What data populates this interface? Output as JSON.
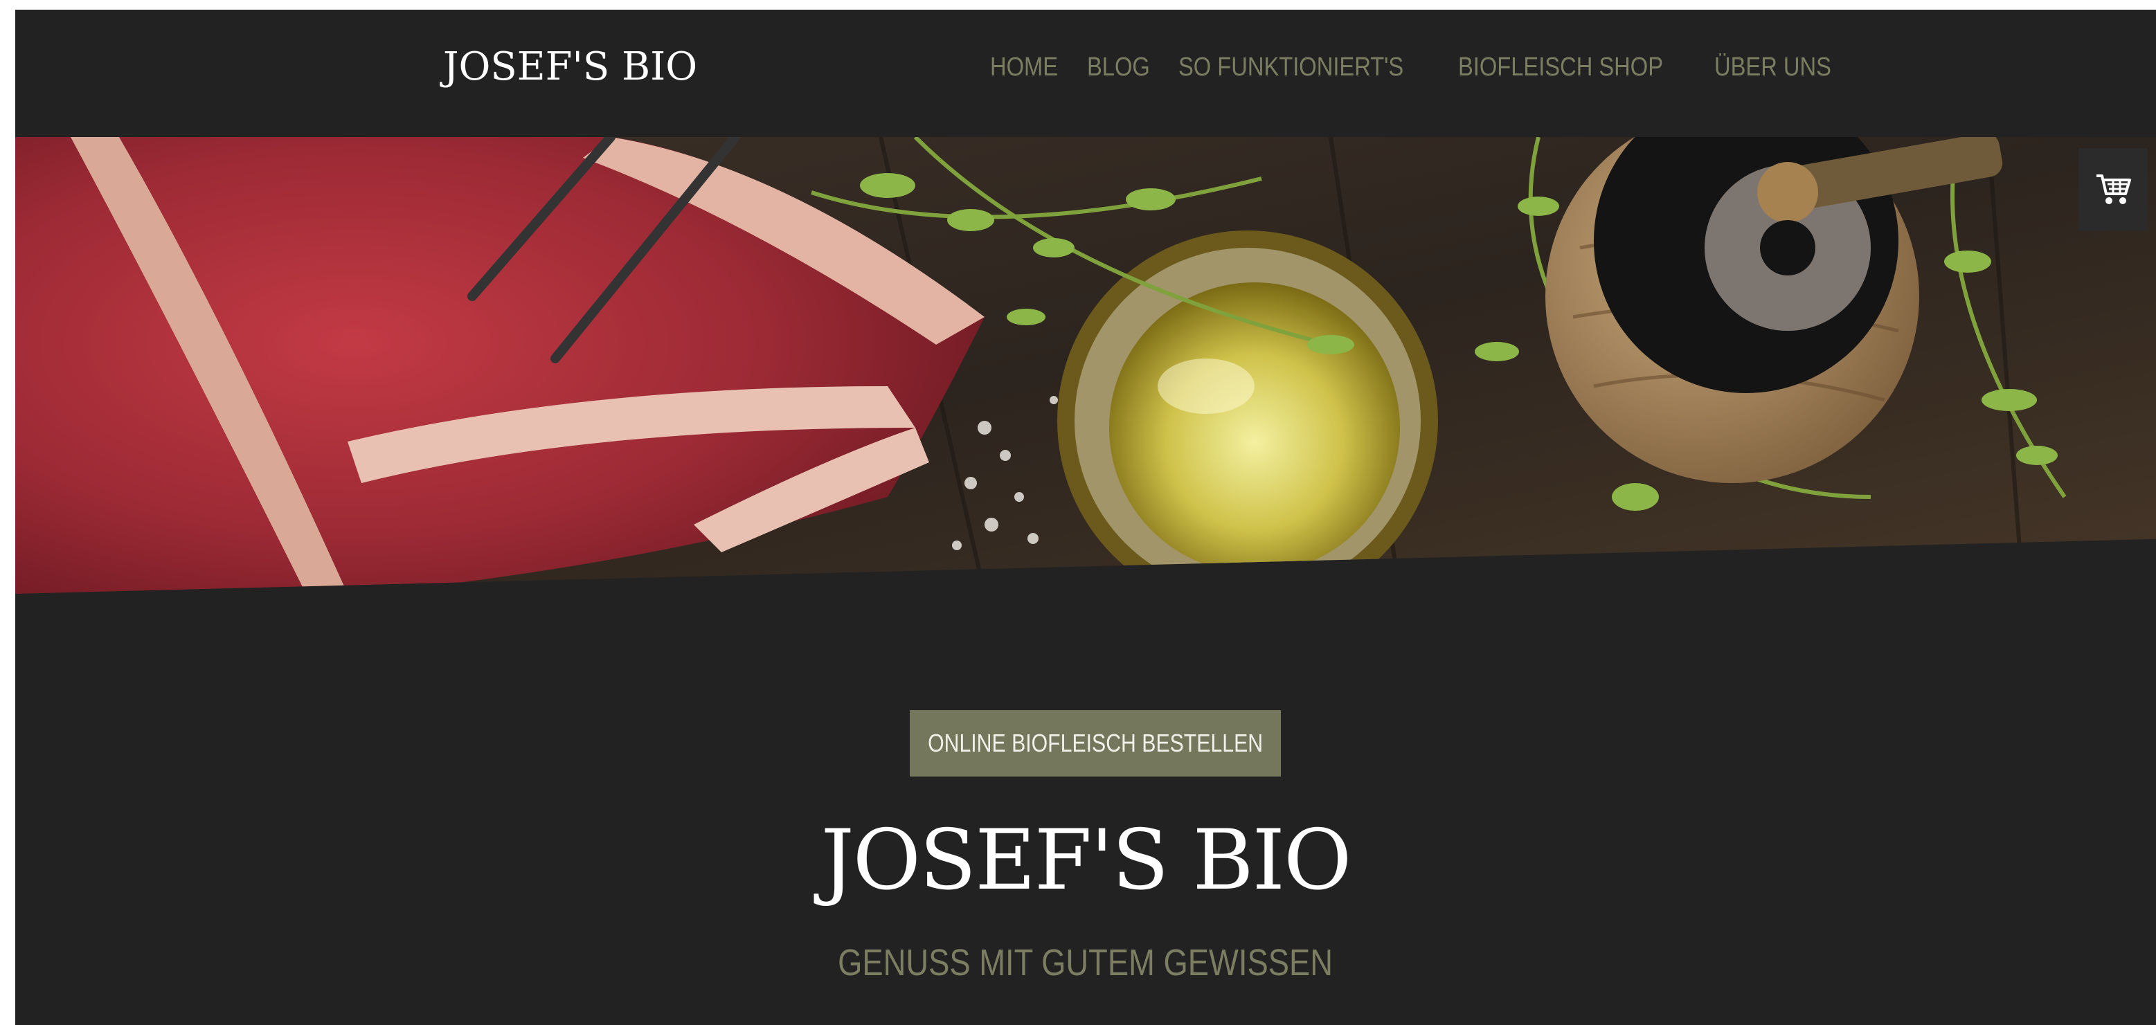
{
  "brand": {
    "logo": "JOSEF'S BIO"
  },
  "nav": {
    "items": [
      {
        "label": "HOME"
      },
      {
        "label": "BLOG"
      },
      {
        "label": "SO FUNKTIONIERT'S"
      },
      {
        "label": "BIOFLEISCH SHOP"
      },
      {
        "label": "ÜBER UNS"
      }
    ]
  },
  "hero": {
    "image": "steak-olive-oil-pepper-mill-photo",
    "cart_icon": "shopping-cart-icon"
  },
  "main": {
    "cta_label": "ONLINE BIOFLEISCH BESTELLEN",
    "title": "JOSEF'S BIO",
    "subtitle": "GENUSS MIT GUTEM GEWISSEN"
  },
  "colors": {
    "background": "#222222",
    "accent": "#75775c",
    "nav_text": "#7c7e62",
    "heading": "#ffffff"
  }
}
